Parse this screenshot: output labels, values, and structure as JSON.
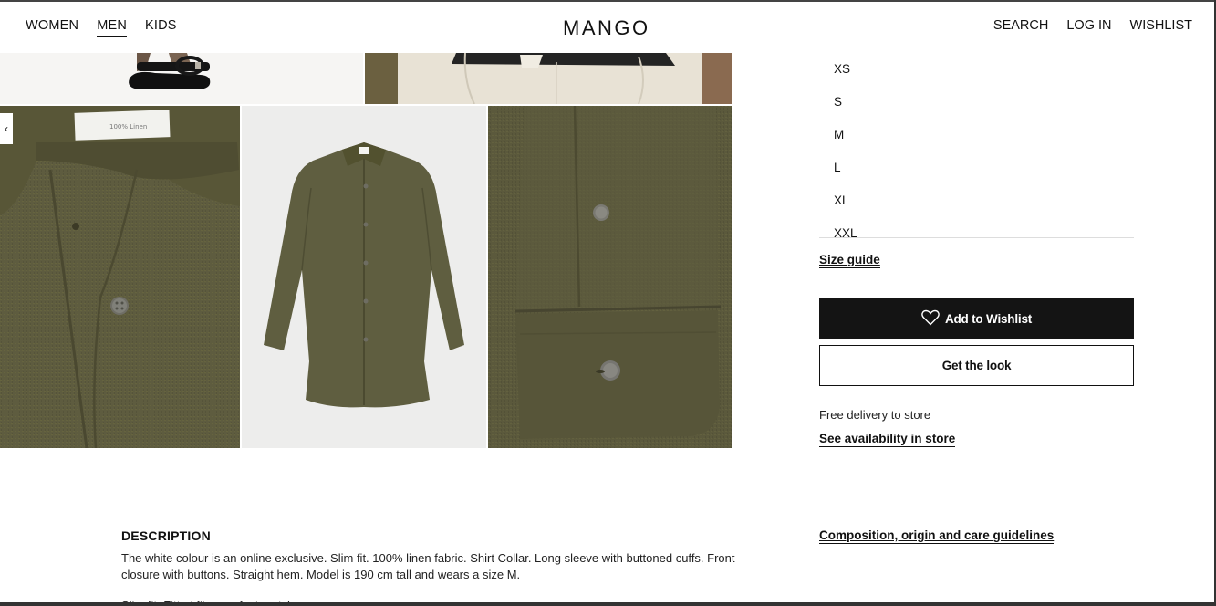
{
  "header": {
    "nav_left": [
      "WOMEN",
      "MEN",
      "KIDS"
    ],
    "active_nav": "MEN",
    "logo": "MANGO",
    "nav_right": [
      "SEARCH",
      "LOG IN",
      "WISHLIST"
    ]
  },
  "gallery": {
    "arrow": "‹",
    "label_on_collar": "100% Linen"
  },
  "sizes": [
    "XS",
    "S",
    "M",
    "L",
    "XL",
    "XXL"
  ],
  "size_guide": "Size guide",
  "actions": {
    "wishlist": "Add to Wishlist",
    "look": "Get the look"
  },
  "delivery": {
    "text": "Free delivery to store",
    "link": "See availability in store"
  },
  "description": {
    "title": "DESCRIPTION",
    "text": "The white colour is an online exclusive. Slim fit. 100% linen fabric. Shirt Collar. Long sleeve with buttoned cuffs. Front closure with buttons. Straight hem. Model is 190 cm tall and wears a size M.",
    "more": "Slim fit: Fitted fit, a perfect match"
  },
  "composition_link": "Composition, origin and care guidelines",
  "colors": {
    "linen_olive": "#5d5b3e",
    "button_black": "#141414",
    "cream": "#e9e3d6"
  }
}
